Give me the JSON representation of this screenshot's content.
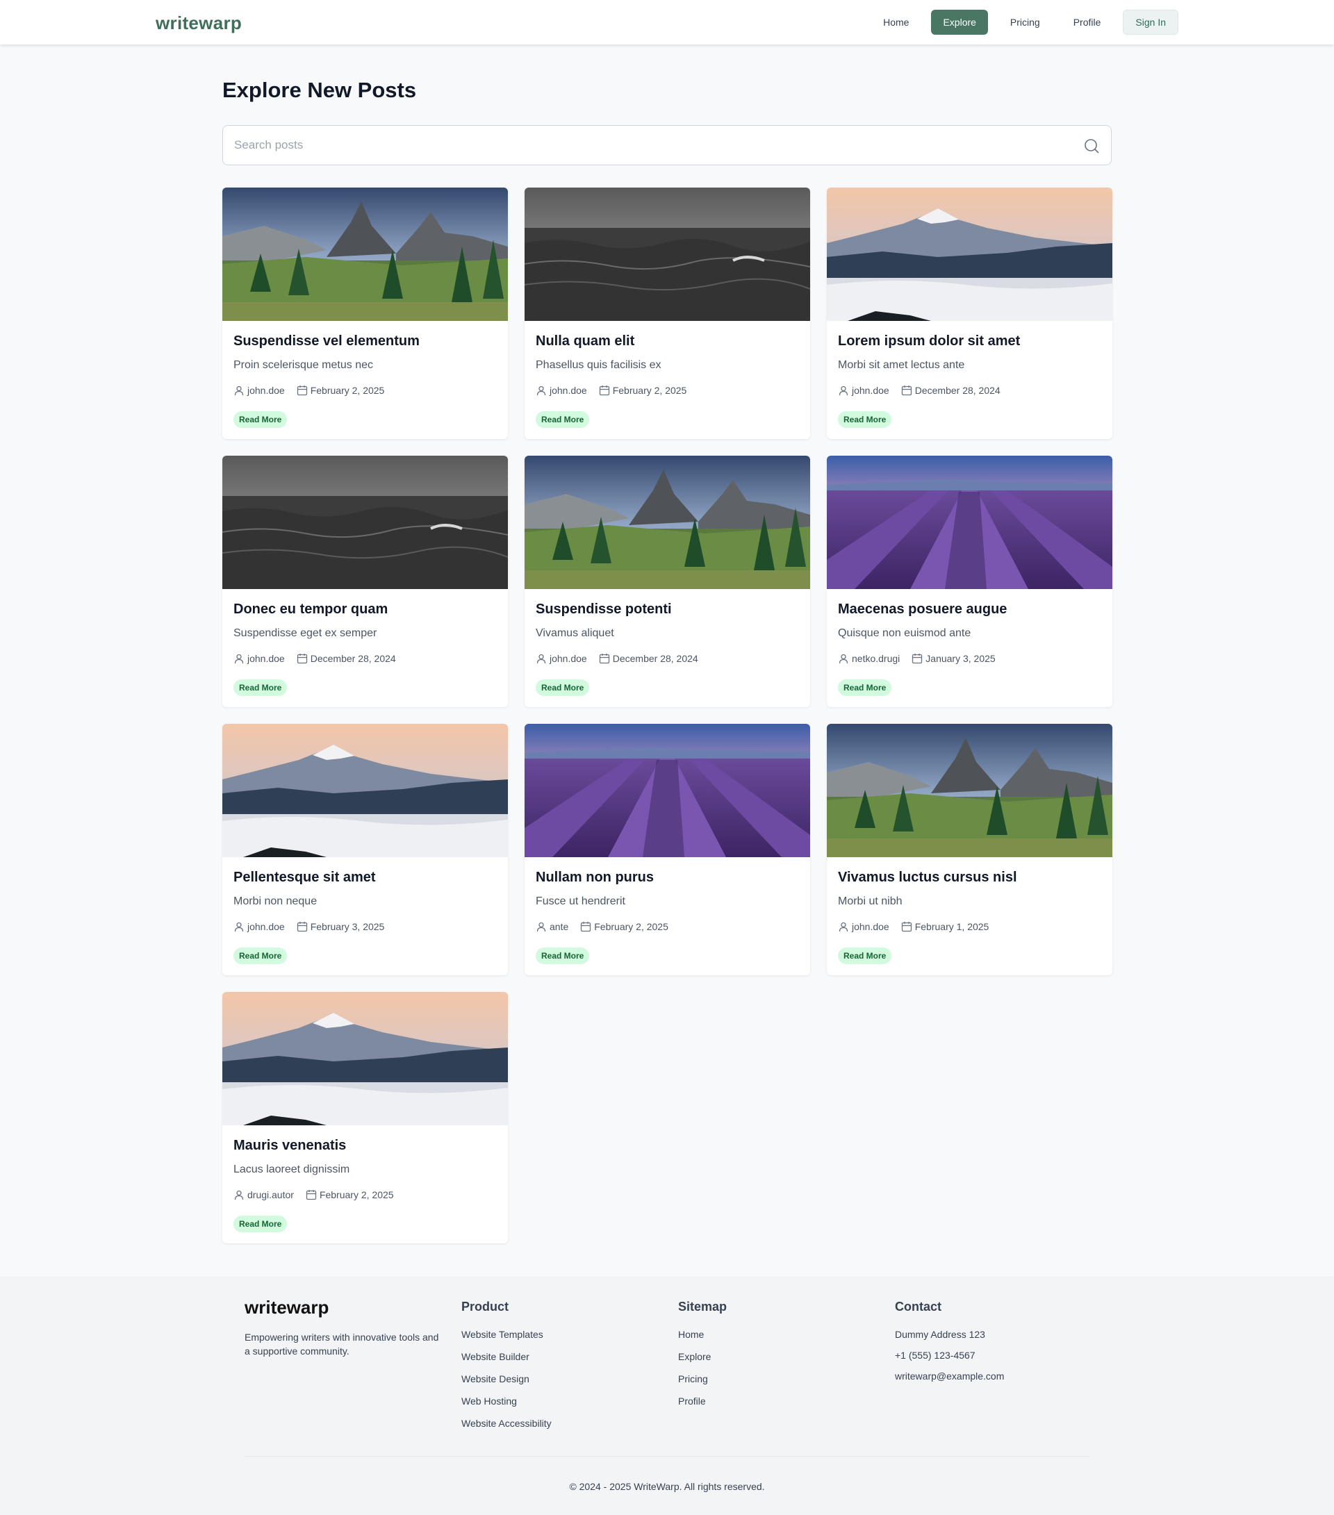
{
  "brand": {
    "name": "writewarp",
    "accent": "#4a7763",
    "badge_bg": "#d1fadf"
  },
  "nav": {
    "items": [
      {
        "label": "Home",
        "active": false
      },
      {
        "label": "Explore",
        "active": true
      },
      {
        "label": "Pricing",
        "active": false
      },
      {
        "label": "Profile",
        "active": false
      }
    ],
    "signin_label": "Sign In"
  },
  "main": {
    "title": "Explore New Posts",
    "search": {
      "placeholder": "Search posts",
      "value": ""
    }
  },
  "posts": [
    {
      "title": "Suspendisse vel elementum",
      "subtitle": "Proin scelerisque metus nec",
      "author": "john.doe",
      "date": "February 2, 2025",
      "image": "mountains",
      "cta": "Read More"
    },
    {
      "title": "Nulla quam elit",
      "subtitle": "Phasellus quis facilisis ex",
      "author": "john.doe",
      "date": "February 2, 2025",
      "image": "sea",
      "cta": "Read More"
    },
    {
      "title": "Lorem ipsum dolor sit amet",
      "subtitle": "Morbi sit amet lectus ante",
      "author": "john.doe",
      "date": "December 28, 2024",
      "image": "volcano",
      "cta": "Read More"
    },
    {
      "title": "Donec eu tempor quam",
      "subtitle": "Suspendisse eget ex semper",
      "author": "john.doe",
      "date": "December 28, 2024",
      "image": "sea",
      "cta": "Read More"
    },
    {
      "title": "Suspendisse potenti",
      "subtitle": "Vivamus aliquet",
      "author": "john.doe",
      "date": "December 28, 2024",
      "image": "mountains",
      "cta": "Read More"
    },
    {
      "title": "Maecenas posuere augue",
      "subtitle": "Quisque non euismod ante",
      "author": "netko.drugi",
      "date": "January 3, 2025",
      "image": "lavender",
      "cta": "Read More"
    },
    {
      "title": "Pellentesque sit amet",
      "subtitle": "Morbi non neque",
      "author": "john.doe",
      "date": "February 3, 2025",
      "image": "volcano",
      "cta": "Read More"
    },
    {
      "title": "Nullam non purus",
      "subtitle": "Fusce ut hendrerit",
      "author": "ante",
      "date": "February 2, 2025",
      "image": "lavender",
      "cta": "Read More"
    },
    {
      "title": "Vivamus luctus cursus nisl",
      "subtitle": "Morbi ut nibh",
      "author": "john.doe",
      "date": "February 1, 2025",
      "image": "mountains",
      "cta": "Read More"
    },
    {
      "title": "Mauris venenatis",
      "subtitle": "Lacus laoreet dignissim",
      "author": "drugi.autor",
      "date": "February 2, 2025",
      "image": "volcano",
      "cta": "Read More"
    }
  ],
  "footer": {
    "brand": "writewarp",
    "description": "Empowering writers with innovative tools and a supportive community.",
    "product": {
      "heading": "Product",
      "links": [
        "Website Templates",
        "Website Builder",
        "Website Design",
        "Web Hosting",
        "Website Accessibility"
      ]
    },
    "sitemap": {
      "heading": "Sitemap",
      "links": [
        "Home",
        "Explore",
        "Pricing",
        "Profile"
      ]
    },
    "contact": {
      "heading": "Contact",
      "address": "Dummy Address 123",
      "phone": "+1 (555) 123-4567",
      "email": "writewarp@example.com"
    },
    "copyright": "© 2024 - 2025 WriteWarp. All rights reserved."
  }
}
